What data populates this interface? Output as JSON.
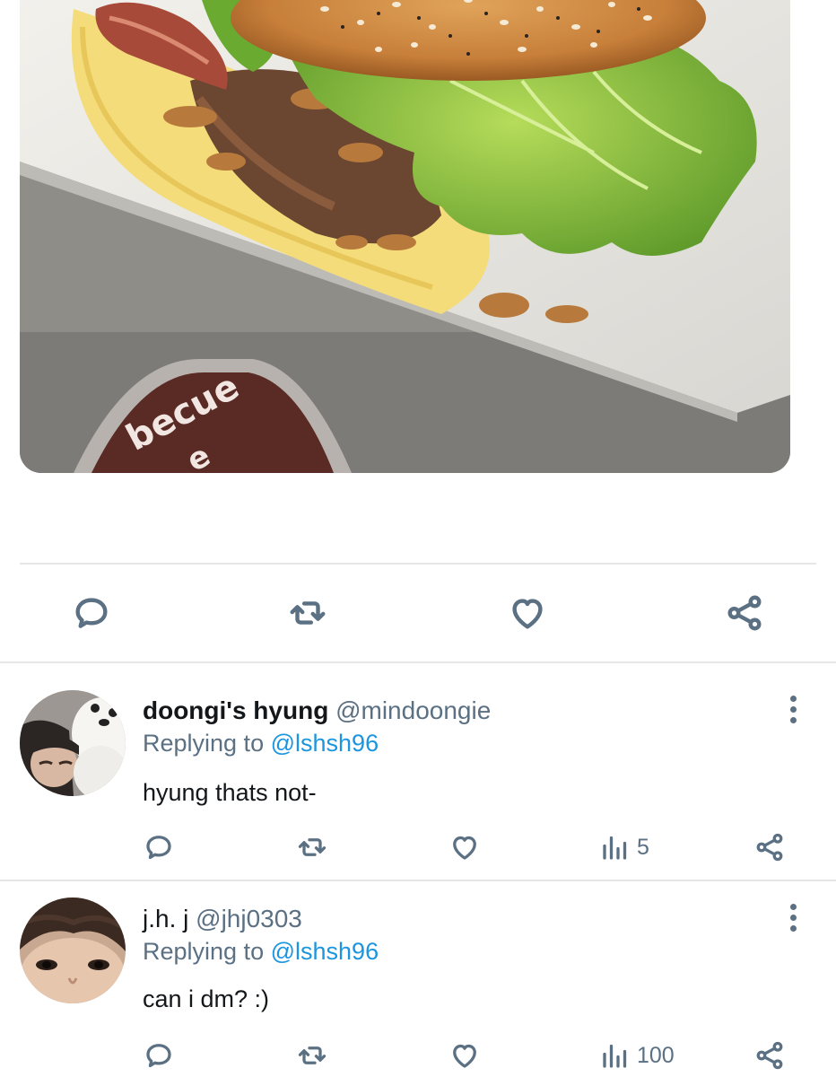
{
  "photo": {
    "alt": "burger photo",
    "sauce_text_1": "becue",
    "sauce_text_2": "e"
  },
  "main_actions": {
    "reply_icon": "reply-icon",
    "retweet_icon": "retweet-icon",
    "like_icon": "heart-icon",
    "share_icon": "share-icon"
  },
  "replies": [
    {
      "name": "doongi's hyung",
      "handle": "@mindoongie",
      "replying_prefix": "Replying to",
      "replying_to": "@lshsh96",
      "text": "hyung thats not-",
      "views": "5"
    },
    {
      "name": "j.h. j",
      "handle": "@jhj0303",
      "replying_prefix": "Replying to",
      "replying_to": "@lshsh96",
      "text": "can i dm? :)",
      "views": "100"
    }
  ],
  "colors": {
    "icon_gray": "#5b7083",
    "link_blue": "#1b95e0",
    "divider": "#e6e6e6"
  }
}
